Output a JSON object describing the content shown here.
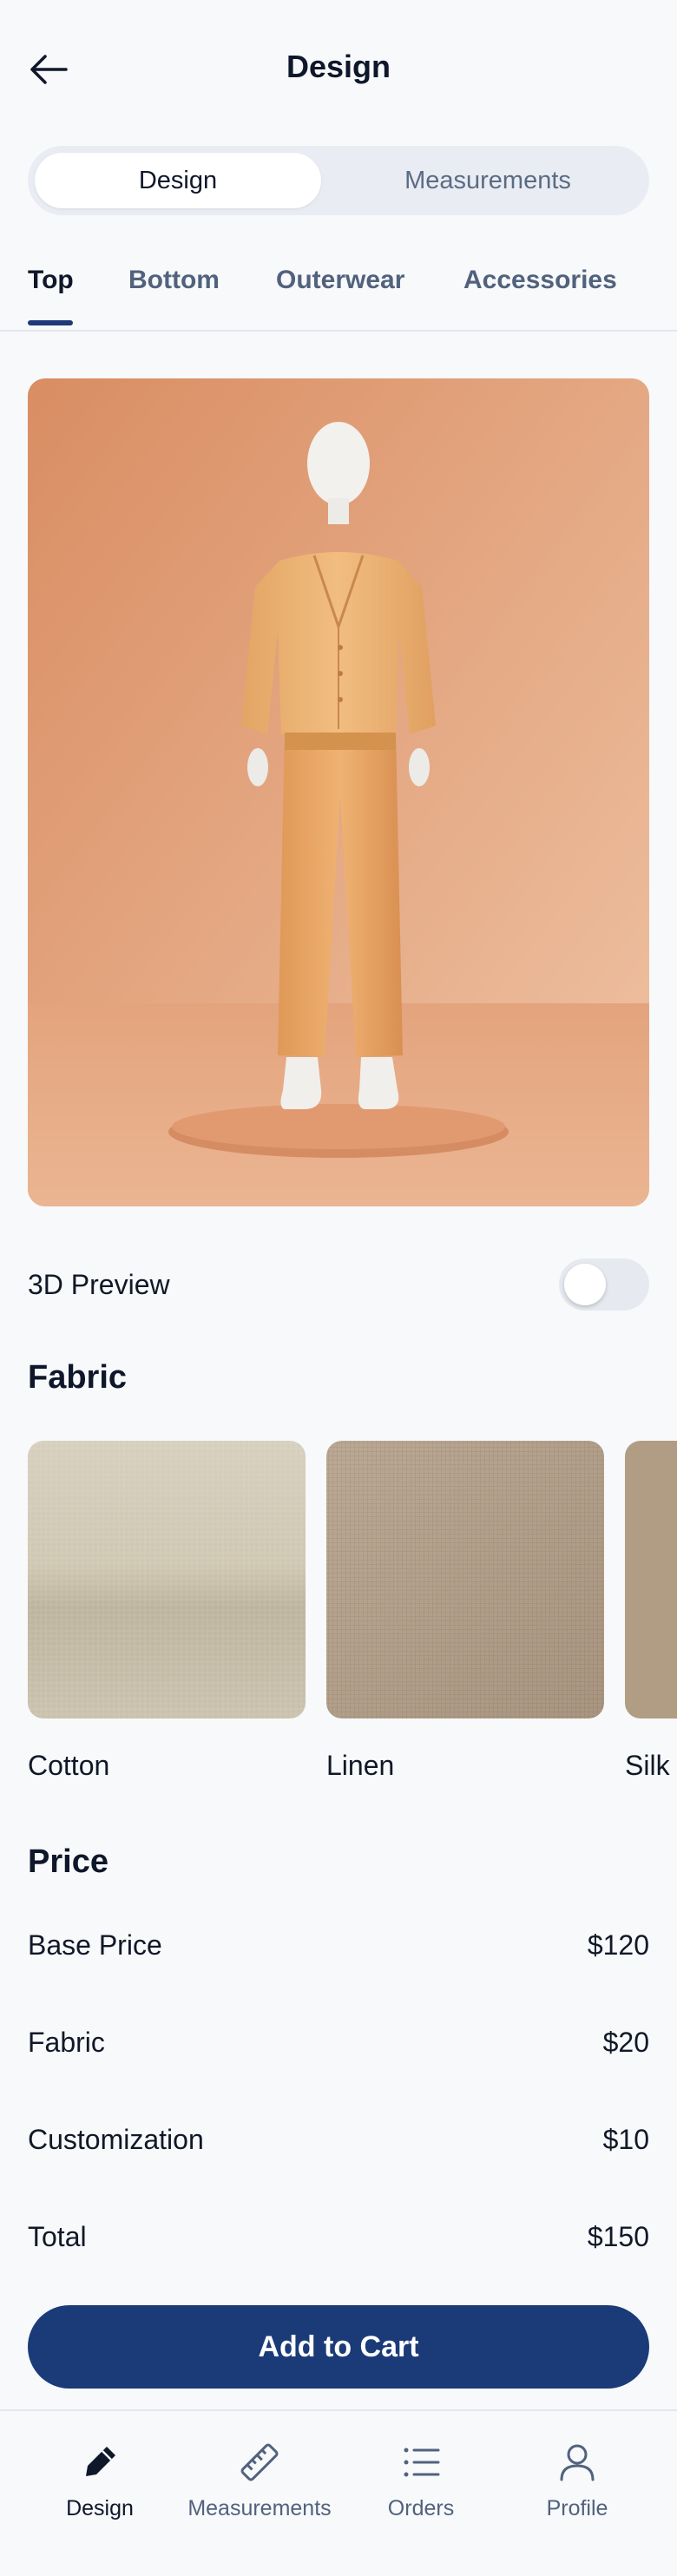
{
  "header": {
    "title": "Design"
  },
  "segmented": {
    "options": [
      "Design",
      "Measurements"
    ],
    "selected": "Design"
  },
  "tabs": {
    "items": [
      "Top",
      "Bottom",
      "Outerwear",
      "Accessories"
    ],
    "selected": "Top"
  },
  "preview_toggle": {
    "label": "3D Preview",
    "on": false
  },
  "fabric": {
    "title": "Fabric",
    "items": [
      {
        "label": "Cotton",
        "color": "#d4cdbb"
      },
      {
        "label": "Linen",
        "color": "#b6a38d"
      },
      {
        "label": "Silk",
        "color": "#b19d83"
      }
    ]
  },
  "price": {
    "title": "Price",
    "rows": [
      {
        "label": "Base Price",
        "value": "$120"
      },
      {
        "label": "Fabric",
        "value": "$20"
      },
      {
        "label": "Customization",
        "value": "$10"
      },
      {
        "label": "Total",
        "value": "$150"
      }
    ]
  },
  "cart": {
    "label": "Add to Cart"
  },
  "nav": {
    "items": [
      {
        "label": "Design",
        "icon": "pencil-icon",
        "active": true
      },
      {
        "label": "Measurements",
        "icon": "ruler-icon",
        "active": false
      },
      {
        "label": "Orders",
        "icon": "list-icon",
        "active": false
      },
      {
        "label": "Profile",
        "icon": "user-icon",
        "active": false
      }
    ]
  },
  "colors": {
    "accent": "#1b3a78",
    "background": "#f7f9fb",
    "garment": "#e8a56a"
  }
}
